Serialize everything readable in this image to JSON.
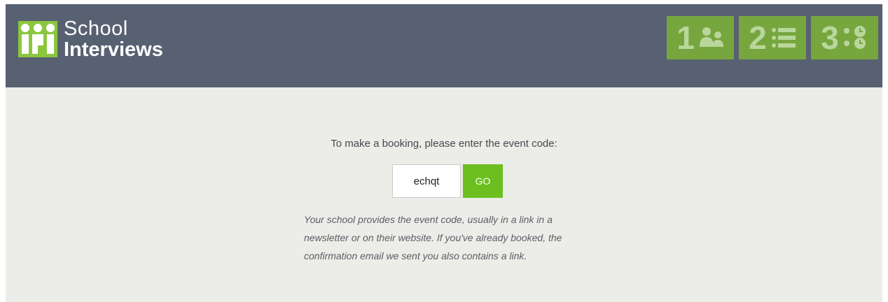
{
  "brand": {
    "line1": "School",
    "line2": "Interviews",
    "accent": "#8cc63f",
    "header_bg": "#586171"
  },
  "steps": [
    {
      "number": "1",
      "icon": "people-icon"
    },
    {
      "number": "2",
      "icon": "list-icon"
    },
    {
      "number": "3",
      "icon": "clock-list-icon"
    }
  ],
  "booking": {
    "prompt": "To make a booking, please enter the event code:",
    "code_value": "echqt",
    "go_label": "GO",
    "help_text": "Your school provides the event code, usually in a link in a newsletter or on their website. If you've already booked, the confirmation email we sent you also contains a link."
  },
  "colors": {
    "go_button": "#6cbf1e",
    "step_tile": "#77a63f",
    "page_bg": "#ecece8"
  }
}
